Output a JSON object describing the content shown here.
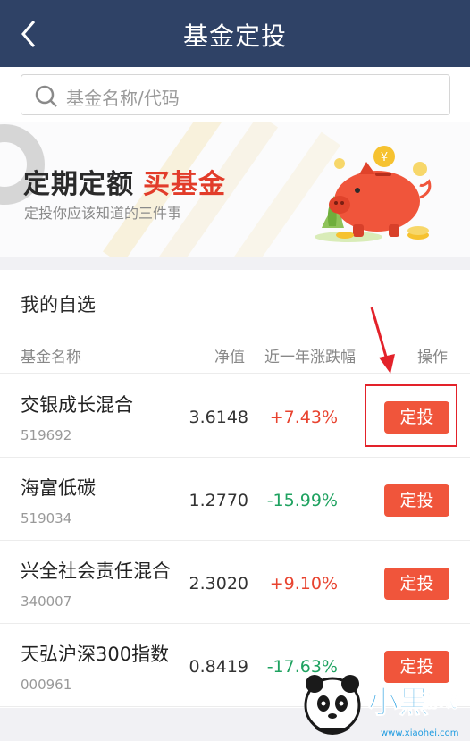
{
  "header": {
    "title": "基金定投",
    "back_icon": "chevron-left-icon"
  },
  "search": {
    "placeholder": "基金名称/代码",
    "icon": "search-icon"
  },
  "banner": {
    "headline_main": "定期定额",
    "headline_accent": "买基金",
    "subtitle": "定投你应该知道的三件事"
  },
  "watchlist": {
    "title": "我的自选",
    "columns": {
      "name": "基金名称",
      "nav": "净值",
      "change": "近一年涨跌幅",
      "action": "操作"
    },
    "rows": [
      {
        "name": "交银成长混合",
        "code": "519692",
        "nav": "3.6148",
        "change": "+7.43%",
        "direction": "up",
        "action": "定投"
      },
      {
        "name": "海富低碳",
        "code": "519034",
        "nav": "1.2770",
        "change": "-15.99%",
        "direction": "down",
        "action": "定投"
      },
      {
        "name": "兴全社会责任混合",
        "code": "340007",
        "nav": "2.3020",
        "change": "+9.10%",
        "direction": "up",
        "action": "定投"
      },
      {
        "name": "天弘沪深300指数",
        "code": "000961",
        "nav": "0.8419",
        "change": "-17.63%",
        "direction": "down",
        "action": "定投"
      }
    ]
  },
  "colors": {
    "header_bg": "#2f4266",
    "button_bg": "#f0553b",
    "up": "#e8432f",
    "down": "#1fa260",
    "highlight": "#e3222a"
  },
  "watermark": {
    "brand": "小黑游戏",
    "url": "www.xiaohei.com"
  }
}
